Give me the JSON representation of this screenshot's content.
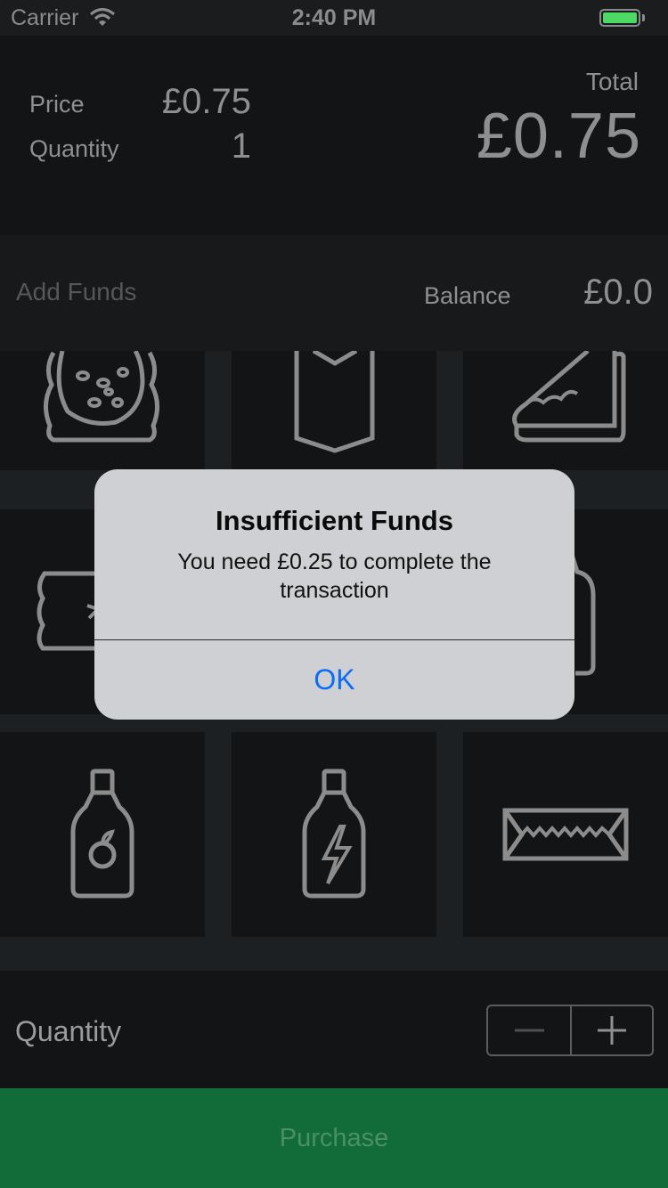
{
  "status_bar": {
    "carrier": "Carrier",
    "time": "2:40 PM",
    "battery_color": "#4cd964"
  },
  "summary": {
    "price_label": "Price",
    "price_value": "£0.75",
    "quantity_label": "Quantity",
    "quantity_value": "1",
    "total_label": "Total",
    "total_value": "£0.75"
  },
  "funds": {
    "add_funds_label": "Add Funds",
    "balance_label": "Balance",
    "balance_value": "£0.0"
  },
  "products": [
    {
      "icon": "cookie-icon"
    },
    {
      "icon": "wrapped-snack-icon"
    },
    {
      "icon": "sandwich-icon"
    },
    {
      "icon": "candy-bar-icon"
    },
    {
      "icon": "product-icon"
    },
    {
      "icon": "drink-carton-icon"
    },
    {
      "icon": "juice-bottle-icon"
    },
    {
      "icon": "energy-drink-icon"
    },
    {
      "icon": "chocolate-bar-icon"
    }
  ],
  "quantity_row": {
    "label": "Quantity",
    "minus_icon": "minus-icon",
    "plus_icon": "plus-icon"
  },
  "purchase": {
    "label": "Purchase",
    "color": "#126c39"
  },
  "alert": {
    "title": "Insufficient Funds",
    "message": "You need £0.25 to complete the transaction",
    "ok_label": "OK",
    "ok_color": "#0b6cf6"
  }
}
